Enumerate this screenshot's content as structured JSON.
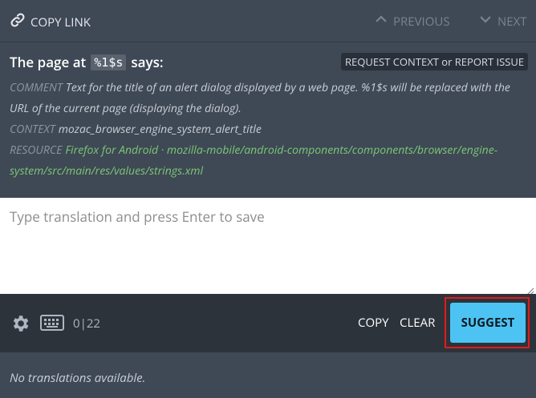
{
  "topbar": {
    "copy_link": "COPY LINK",
    "previous": "PREVIOUS",
    "next": "NEXT"
  },
  "meta": {
    "title_prefix": "The page at",
    "title_token": "%1$s",
    "title_suffix": "says:",
    "request_button": "REQUEST CONTEXT or REPORT ISSUE",
    "comment_label": "COMMENT",
    "comment_text": "Text for the title of an alert dialog displayed by a web page. %1$s will be replaced with the URL of the current page (displaying the dialog).",
    "context_label": "CONTEXT",
    "context_text": "mozac_browser_engine_system_alert_title",
    "resource_label": "RESOURCE",
    "resource_text": "Firefox for Android · mozilla-mobile/android-components/components/browser/engine-system/src/main/res/values/strings.xml"
  },
  "editor": {
    "placeholder": "Type translation and press Enter to save",
    "value": ""
  },
  "toolbar": {
    "counter": "0|22",
    "copy": "COPY",
    "clear": "CLEAR",
    "suggest": "SUGGEST"
  },
  "footer": {
    "message": "No translations available."
  },
  "colors": {
    "panel": "#3f4855",
    "toolbar": "#2d333b",
    "accent": "#4dc3f3",
    "resource": "#7bc876",
    "highlight": "#e11b1b"
  },
  "icons": {
    "copy_link": "link-icon",
    "previous": "chevron-up-icon",
    "next": "chevron-down-icon",
    "settings": "gear-icon",
    "keyboard": "keyboard-icon"
  }
}
